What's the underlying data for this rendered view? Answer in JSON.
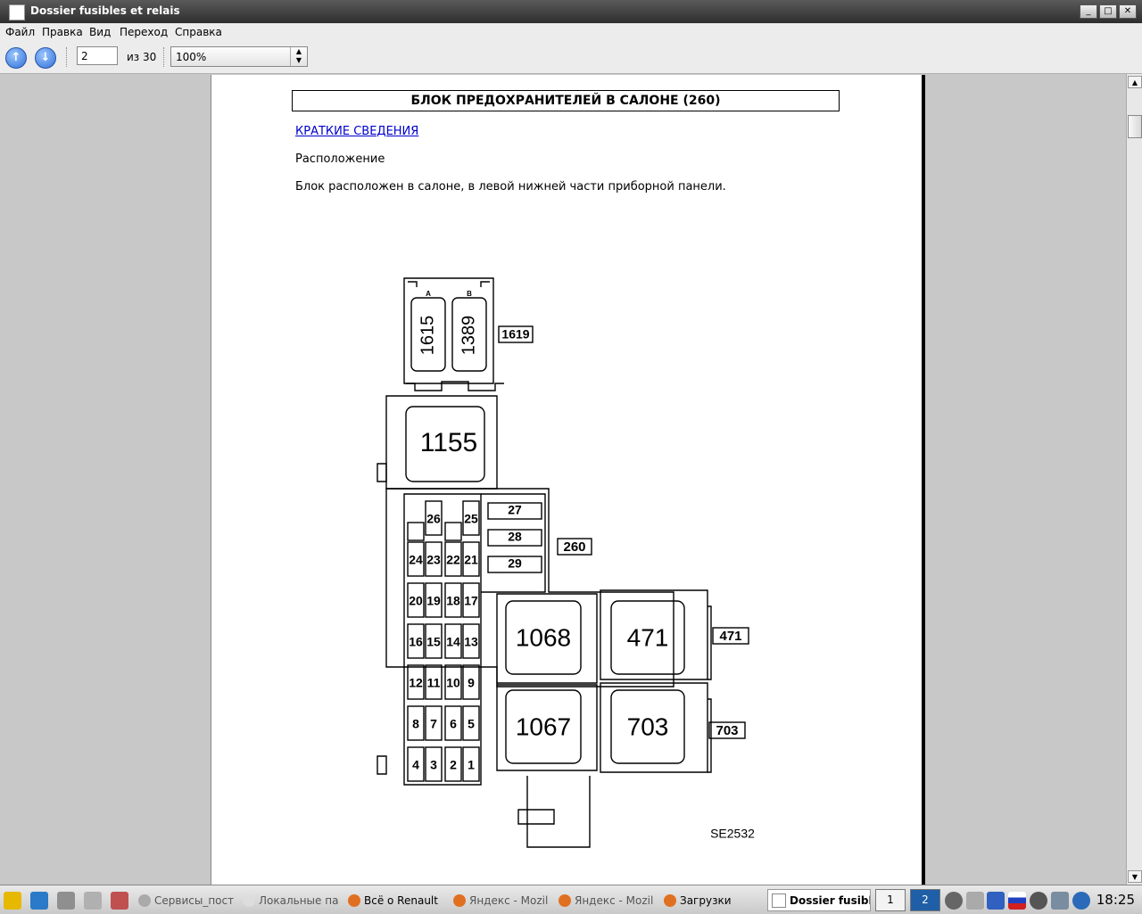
{
  "window": {
    "title": "Dossier fusibles et relais"
  },
  "menu": [
    "Файл",
    "Правка",
    "Вид",
    "Переход",
    "Справка"
  ],
  "toolbar": {
    "page": "2",
    "page_of": "из 30",
    "zoom": "100%"
  },
  "document": {
    "title": "БЛОК ПРЕДОХРАНИТЕЛЕЙ В САЛОНЕ (260)",
    "link": "КРАТКИЕ СВЕДЕНИЯ",
    "heading": "Расположение",
    "body": "Блок расположен в салоне, в левой нижней части приборной панели.",
    "diagram": {
      "top_relays": [
        "1615",
        "1389"
      ],
      "top_slot_labels": [
        "A",
        "B"
      ],
      "top_block_label": "1619",
      "relay_main": "1155",
      "fuses_top": [
        "26",
        "25"
      ],
      "fuse_rows": [
        [
          "24",
          "23",
          "22",
          "21"
        ],
        [
          "20",
          "19",
          "18",
          "17"
        ],
        [
          "16",
          "15",
          "14",
          "13"
        ],
        [
          "12",
          "11",
          "10",
          "9"
        ],
        [
          "8",
          "7",
          "6",
          "5"
        ],
        [
          "4",
          "3",
          "2",
          "1"
        ]
      ],
      "maxi_fuses": [
        "27",
        "28",
        "29"
      ],
      "box_label": "260",
      "relays_large": [
        "1068",
        "471",
        "1067",
        "703"
      ],
      "relay_labels": [
        "471",
        "703"
      ],
      "figure_code": "SE2532"
    }
  },
  "taskbar": {
    "tasks": [
      "Сервисы_пост",
      "Локальные па",
      "Всё о Renault",
      "Яндекс - Mozil",
      "Яндекс - Mozil",
      "Загрузки",
      "Dossier fusible"
    ],
    "desktops": [
      "1",
      "2"
    ],
    "clock": "18:25"
  },
  "colors": {
    "link": "#0000cc",
    "active_desktop": "#1f5fa8"
  }
}
